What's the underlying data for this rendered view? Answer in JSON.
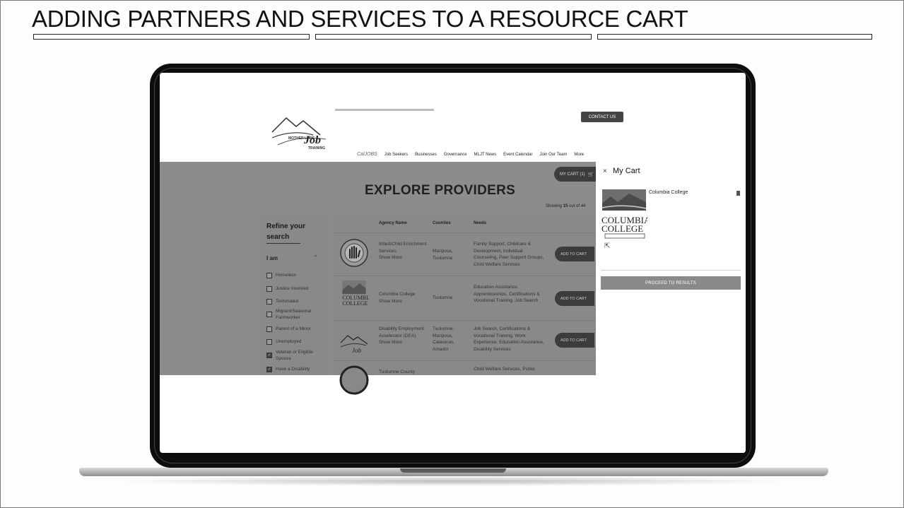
{
  "slide": {
    "title": "ADDING PARTNERS AND SERVICES TO A RESOURCE CART"
  },
  "site": {
    "logo": {
      "line1": "MOTHER LODE",
      "line2": "Job",
      "line3": "TRAINING"
    },
    "contact_label": "CONTACT US",
    "nav": [
      "CalJOBS",
      "Job Seekers",
      "Businesses",
      "Governance",
      "MLJT News",
      "Event Calendar",
      "Join Our Team",
      "More"
    ],
    "page_title": "EXPLORE PROVIDERS",
    "my_cart_label": "MY CART (1)",
    "showing_prefix": "Showing ",
    "showing_count": "15",
    "showing_suffix": " out of 44",
    "refine_title": "Refine your search",
    "iam_label": "I am",
    "filters": [
      {
        "label": "Homeless",
        "checked": false
      },
      {
        "label": "Justice Involved",
        "checked": false
      },
      {
        "label": "Terminated",
        "checked": false
      },
      {
        "label": "Migrant/Seasonal Farmworker",
        "checked": false
      },
      {
        "label": "Parent of a Minor",
        "checked": false
      },
      {
        "label": "Unemployed",
        "checked": false
      },
      {
        "label": "Veteran or Eligible Spouse",
        "checked": true
      },
      {
        "label": "Have a Disability",
        "checked": true
      }
    ],
    "columns": {
      "agency": "Agency Name",
      "counties": "Counties",
      "needs": "Needs"
    },
    "rows": [
      {
        "agency": "Infant/Child Enrichment Services",
        "show_more": "Show More",
        "counties": "Mariposa, Tuolumne",
        "needs": "Family Support, Childcare & Development, Individual Counseling, Peer Support Groups, Child Welfare Services",
        "button": "ADD TO CART"
      },
      {
        "agency": "Columbia College",
        "show_more": "Show More",
        "counties": "Tuolumne",
        "needs": "Education Assistance, Apprenticeships, Certifications & Vocational Training, Job Search",
        "button": "ADD TO CART"
      },
      {
        "agency": "Disability Employment Accelerator (DEA)",
        "show_more": "Show More",
        "counties": "Tuolumne, Mariposa, Calaveras, Amador",
        "needs": "Job Search, Certifications & Vocational Training, Work Experience, Education Assistance, Disability Services",
        "button": "ADD TO CART"
      },
      {
        "agency": "Tuolumne County",
        "show_more": "",
        "counties": "",
        "needs": "Child Welfare Services, Public",
        "button": ""
      }
    ],
    "cart": {
      "title": "My Cart",
      "close": "×",
      "item": "Columbia College",
      "proceed": "PROCEED TO RESULTS"
    }
  }
}
